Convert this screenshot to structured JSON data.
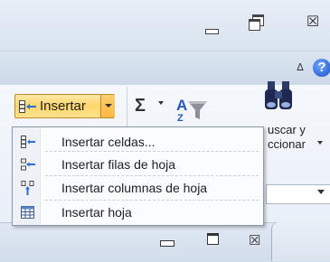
{
  "window": {
    "close_glyph": "☒"
  },
  "ribbon": {
    "help_glyph": "?",
    "collapse_glyph": "ᐃ",
    "insert_label": "Insertar",
    "sigma_glyph": "Σ",
    "find_label_line1": "uscar y",
    "find_label_line2": "ccionar"
  },
  "insert_menu": [
    {
      "label": "Insertar celdas...",
      "icon": "insert-cells-icon"
    },
    {
      "label": "Insertar filas de hoja",
      "icon": "insert-rows-icon"
    },
    {
      "label": "Insertar columnas de hoja",
      "icon": "insert-columns-icon"
    },
    {
      "label": "Insertar hoja",
      "icon": "insert-sheet-icon"
    }
  ],
  "inner_window": {
    "close_glyph": "☒"
  },
  "colors": {
    "menu_border": "#8a99ad",
    "button_highlight": "#ffd66b",
    "help_blue": "#1a4fc7"
  }
}
